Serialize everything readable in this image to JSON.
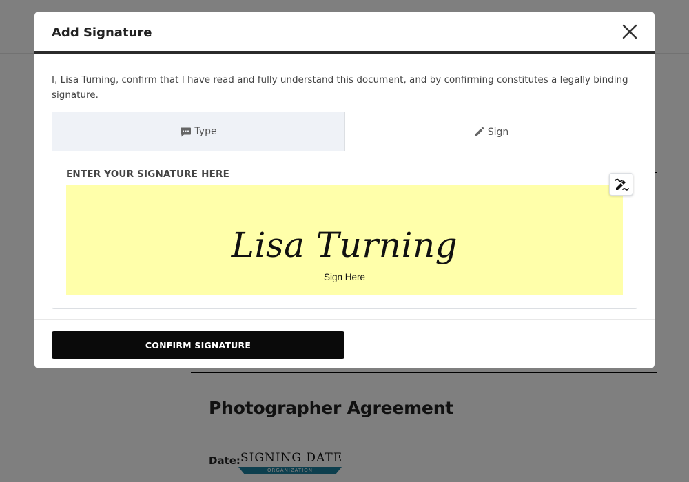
{
  "document": {
    "title": "Photographer Agreement",
    "date_label": "Date:",
    "date_field": {
      "label": "SIGNING DATE",
      "sublabel": "ORGANIZATION",
      "bar_color": "#1a7f9c"
    }
  },
  "modal": {
    "title": "Add Signature",
    "close_icon": "close-icon",
    "consent_text": "I, Lisa Turning, confirm that I have read and fully understand this document, and by confirming constitutes a legally binding signature.",
    "tabs": [
      {
        "label": "Type",
        "icon": "message-icon",
        "active": false
      },
      {
        "label": "Sign",
        "icon": "pencil-icon",
        "active": true
      }
    ],
    "signature_pad": {
      "label": "ENTER YOUR SIGNATURE HERE",
      "signature_text": "Lisa Turning",
      "guide_text": "Sign Here",
      "background_color": "#ffffaa",
      "clear_icon": "eraser-icon"
    },
    "confirm_button": "CONFIRM SIGNATURE"
  },
  "colors": {
    "overlay": "rgba(0,0,0,0.5)",
    "header_rule": "#2b2b2b",
    "confirm_button_bg": "#0a0a0a",
    "inactive_tab_bg": "#eff2f7"
  }
}
